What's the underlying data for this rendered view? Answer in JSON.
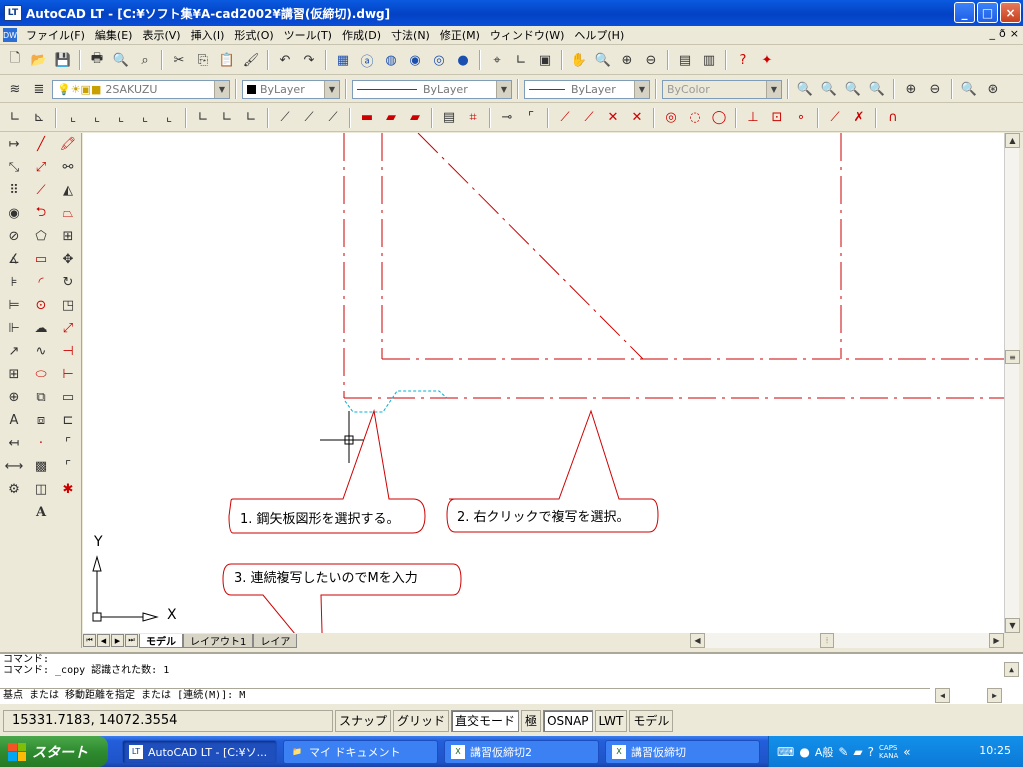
{
  "window": {
    "app_icon": "LT",
    "title": "AutoCAD LT - [C:¥ソフト集¥A-cad2002¥講習(仮締切).dwg]",
    "minimize_label": "_",
    "maximize_label": "□",
    "close_label": "×"
  },
  "menu": {
    "doc_icon": "DW",
    "items": [
      "ファイル(F)",
      "編集(E)",
      "表示(V)",
      "挿入(I)",
      "形式(O)",
      "ツール(T)",
      "作成(D)",
      "寸法(N)",
      "修正(M)",
      "ウィンドウ(W)",
      "ヘルプ(H)"
    ],
    "mdi_min": "_",
    "mdi_restore": "ð",
    "mdi_close": "×"
  },
  "layer_toolbar": {
    "layer_name": "2SAKUZU",
    "color": "ByLayer",
    "linetype": "ByLayer",
    "lineweight": "ByLayer",
    "plotstyle": "ByColor"
  },
  "drawing": {
    "callouts": [
      "1. 鋼矢板図形を選択する。",
      "2. 右クリックで複写を選択。",
      "3. 連続複写したいのでMを入力"
    ],
    "ucs_y": "Y",
    "ucs_x": "X",
    "colors": {
      "line": "#cc0000",
      "highlight": "#00b0d0"
    }
  },
  "layout_tabs": [
    "モデル",
    "レイアウト1",
    "レイア"
  ],
  "command": {
    "history": [
      "コマンド:",
      "コマンド: _copy 認識された数: 1"
    ],
    "input": "基点 または 移動距離を指定 または [連続(M)]: M"
  },
  "status": {
    "coords": "15331.7183, 14072.3554",
    "buttons": [
      "スナップ",
      "グリッド",
      "直交モード",
      "極",
      "OSNAP",
      "LWT",
      "モデル"
    ]
  },
  "taskbar": {
    "start": "スタート",
    "tasks": [
      {
        "label": "AutoCAD LT - [C:¥ソ...",
        "icon": "LT"
      },
      {
        "label": "マイ ドキュメント",
        "icon": "📁"
      },
      {
        "label": "講習仮締切2",
        "icon": "X"
      },
      {
        "label": "講習仮締切",
        "icon": "X"
      }
    ],
    "tray_ime": "A般",
    "tray_caps": "CAPS",
    "tray_kana": "KANA",
    "clock": "10:25"
  }
}
